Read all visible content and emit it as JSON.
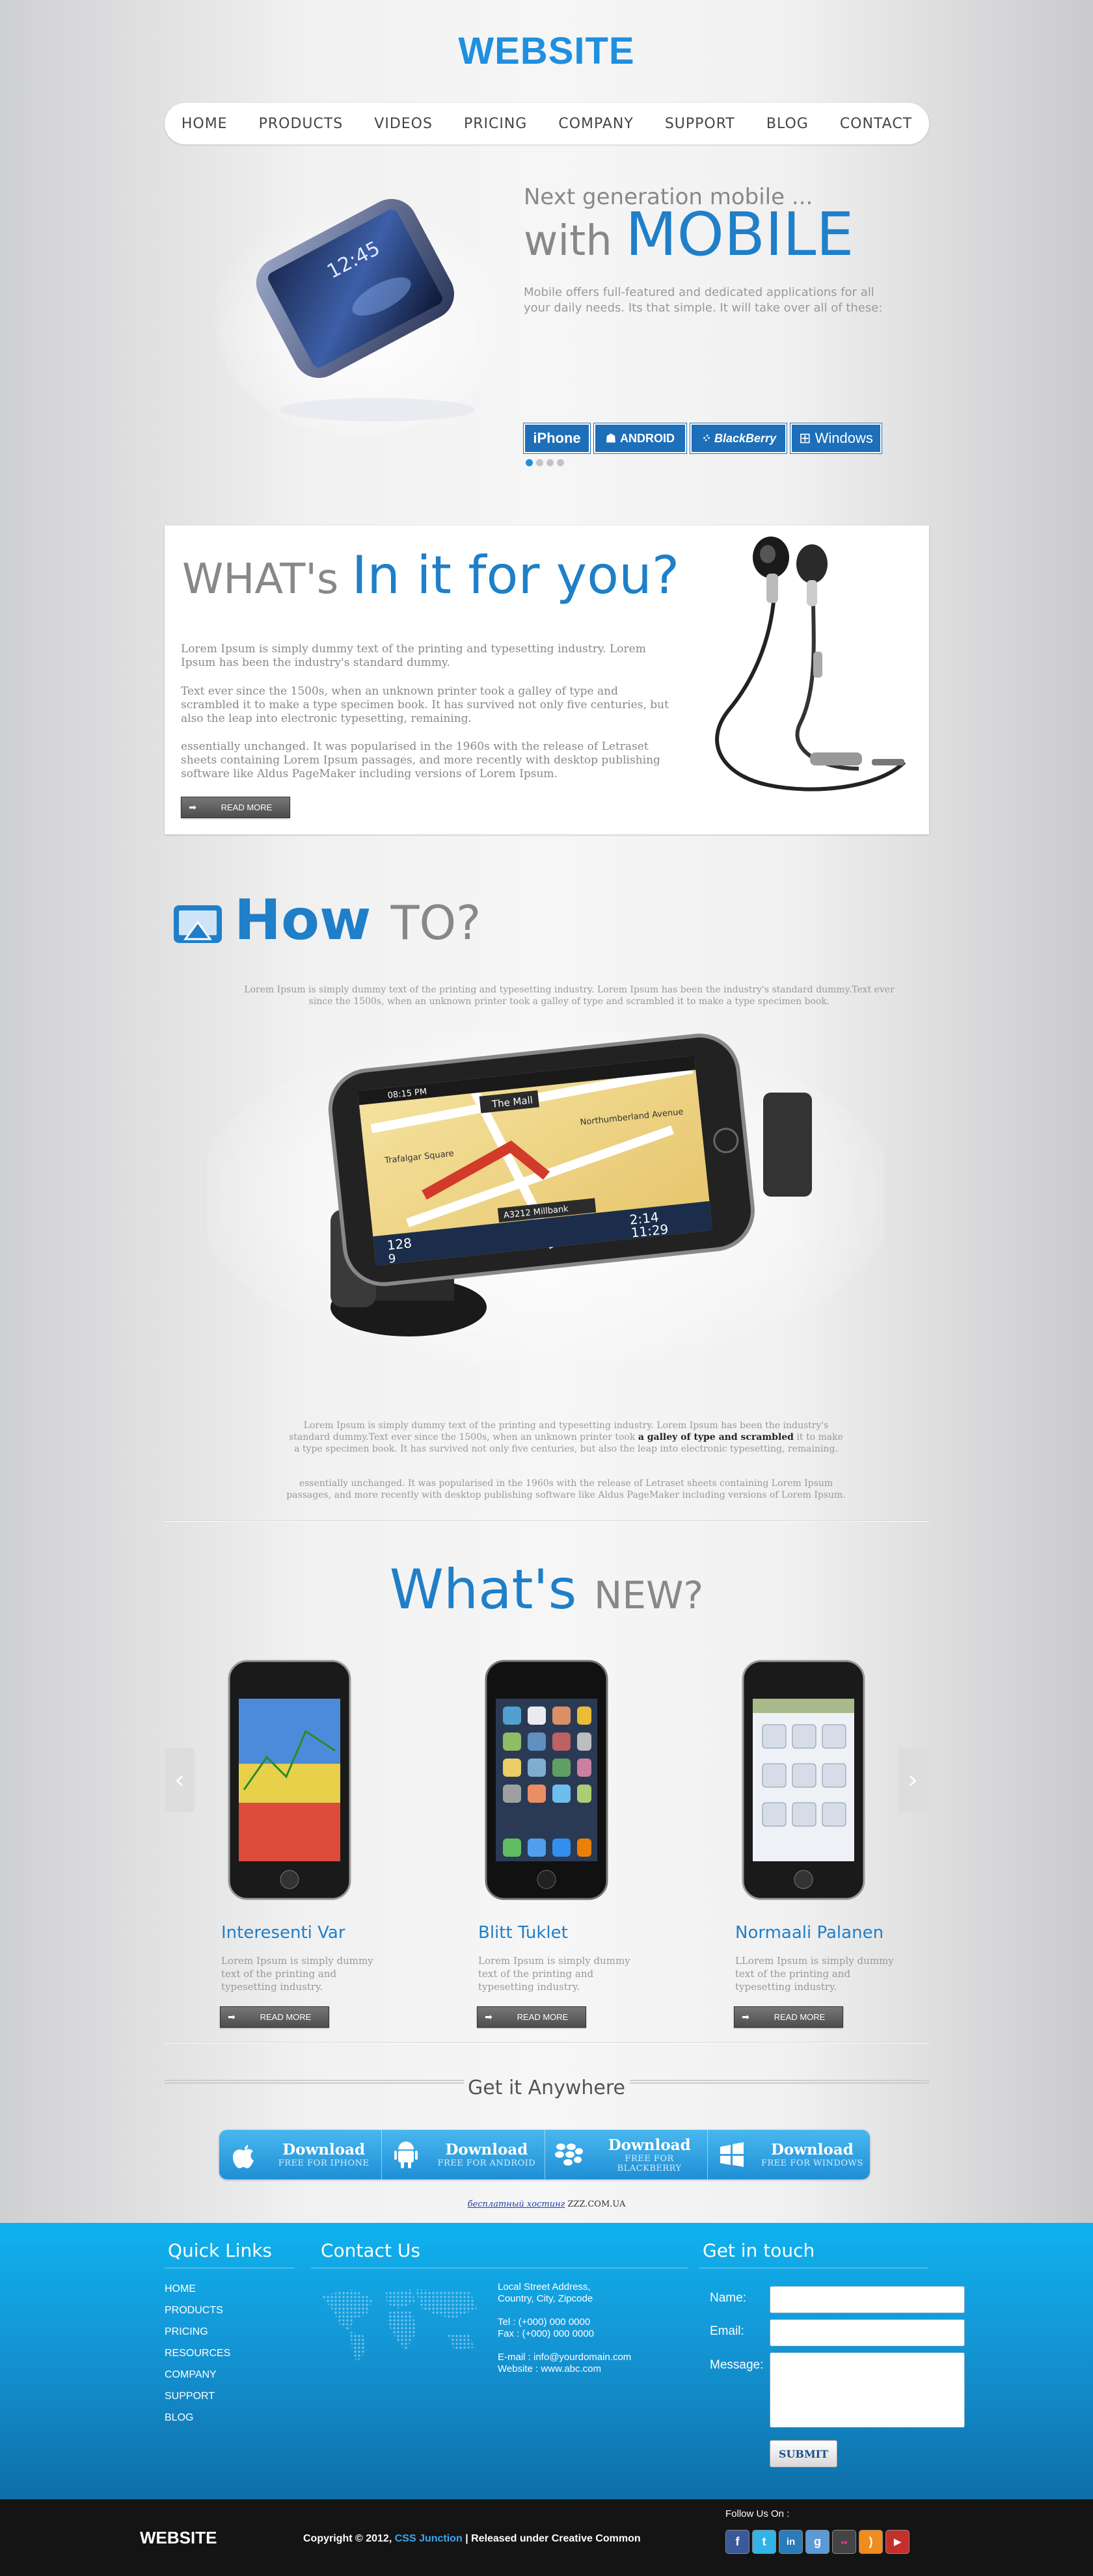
{
  "header": {
    "logo": "WEBSITE",
    "nav": [
      "HOME",
      "PRODUCTS",
      "VIDEOS",
      "PRICING",
      "COMPANY",
      "SUPPORT",
      "BLOG",
      "CONTACT"
    ]
  },
  "hero": {
    "tagline": "Next generation mobile ...",
    "title_prefix": "with",
    "title_main": "MOBILE",
    "description": "Mobile offers full-featured and dedicated applications for all your daily needs. Its that simple. It will take over all of these:",
    "platforms": [
      "iPhone",
      "ANDROID",
      "BlackBerry",
      "Windows"
    ],
    "slide_total": 4,
    "slide_active": 1
  },
  "whats_in": {
    "title_prefix": "WHAT's",
    "title_main": "In it for you?",
    "p1": "Lorem Ipsum is simply dummy text of the printing and typesetting industry. Lorem Ipsum has been the industry's standard dummy.",
    "p2": "Text ever since the 1500s, when an unknown printer took a galley of type and scrambled it to make a type specimen book. It has survived not only five centuries, but also the leap into electronic typesetting, remaining.",
    "p3": "essentially unchanged. It was popularised in the 1960s with the release of Letraset sheets containing Lorem Ipsum passages, and more recently with desktop publishing software like Aldus PageMaker including versions of Lorem Ipsum.",
    "button": "READ MORE"
  },
  "how_to": {
    "title_main": "How",
    "title_sub": "TO?",
    "intro": "Lorem Ipsum is simply dummy text of the printing and typesetting industry. Lorem Ipsum has been the industry's standard dummy.Text ever since the 1500s, when an unknown printer took a galley of type and scrambled it to make a type specimen book.",
    "p1_a": "Lorem Ipsum is simply dummy text of the printing and typesetting industry. Lorem Ipsum has been the industry's standard dummy.Text ever since the 1500s, when an unknown printer took ",
    "p1_bold": "a galley of type and scrambled",
    "p1_b": " it to make a type specimen book. It has survived not only five centuries, but also the leap into electronic typesetting, remaining.",
    "p2": "essentially unchanged. It was popularised in the 1960s with the release of Letraset sheets containing Lorem Ipsum passages, and more recently with desktop publishing software like Aldus PageMaker including versions of Lorem Ipsum.",
    "gps_screen": {
      "street1": "The Mall",
      "street2": "Trafalgar Square",
      "street3": "Northumberland Avenue",
      "road": "A3212 Millbank",
      "time_top": "08:15 PM",
      "dist": "128",
      "dist2": "9",
      "time1": "2:14",
      "time2": "11:29"
    }
  },
  "whats_new": {
    "title_main": "What's",
    "title_sub": "NEW?",
    "products": [
      {
        "name": "Interesenti Var",
        "desc": "Lorem Ipsum is simply dummy text of the printing and typesetting industry.",
        "button": "READ MORE"
      },
      {
        "name": "Blitt Tuklet",
        "desc": "Lorem Ipsum is simply dummy text of the printing and typesetting industry.",
        "button": "READ MORE"
      },
      {
        "name": "Normaali Palanen",
        "desc": "LLorem Ipsum is simply dummy text of the printing and typesetting industry.",
        "button": "READ MORE"
      }
    ]
  },
  "get_it": {
    "title": "Get it Anywhere",
    "downloads": [
      {
        "label": "Download",
        "sub": "FREE FOR IPHONE"
      },
      {
        "label": "Download",
        "sub": "FREE FOR ANDROID"
      },
      {
        "label": "Download",
        "sub": "FREE FOR BLACKBERRY"
      },
      {
        "label": "Download",
        "sub": "FREE FOR WINDOWS"
      }
    ],
    "credit_link": "бесплатный хостинг",
    "credit_text": "ZZZ.COM.UA"
  },
  "footer": {
    "quick_links_title": "Quick Links",
    "quick_links": [
      "HOME",
      "PRODUCTS",
      "PRICING",
      "RESOURCES",
      "COMPANY",
      "SUPPORT",
      "BLOG"
    ],
    "contact_title": "Contact Us",
    "address1": "Local Street Address,",
    "address2": "Country, City, Zipcode",
    "tel": "Tel : (+000) 000 0000",
    "fax": "Fax : (+000) 000 0000",
    "email": "E-mail : info@yourdomain.com",
    "website": "Website : www.abc.com",
    "touch_title": "Get in touch",
    "name_label": "Name:",
    "email_label": "Email:",
    "message_label": "Message:",
    "submit": "SUBMIT"
  },
  "bottom": {
    "logo": "WEBSITE",
    "copyright_a": "Copyright © 2012,",
    "copyright_link": "CSS Junction",
    "copyright_b": "| Released under Creative Common",
    "follow": "Follow Us On :",
    "socials": [
      {
        "icon": "facebook-icon",
        "glyph": "f",
        "color": "#3b5998"
      },
      {
        "icon": "twitter-icon",
        "glyph": "t",
        "color": "#33b3e6"
      },
      {
        "icon": "linkedin-icon",
        "glyph": "in",
        "color": "#2b7bb9"
      },
      {
        "icon": "google-icon",
        "glyph": "g",
        "color": "#5c9ad6"
      },
      {
        "icon": "flickr-icon",
        "glyph": "••",
        "color": "#444"
      },
      {
        "icon": "rss-icon",
        "glyph": ")",
        "color": "#f08c1e"
      },
      {
        "icon": "youtube-icon",
        "glyph": "▶",
        "color": "#c4302b"
      }
    ]
  },
  "colors": {
    "accent": "#1f7fc8",
    "logo": "#1f8fe0",
    "footer": "#1498d8",
    "bottom": "#141414"
  }
}
